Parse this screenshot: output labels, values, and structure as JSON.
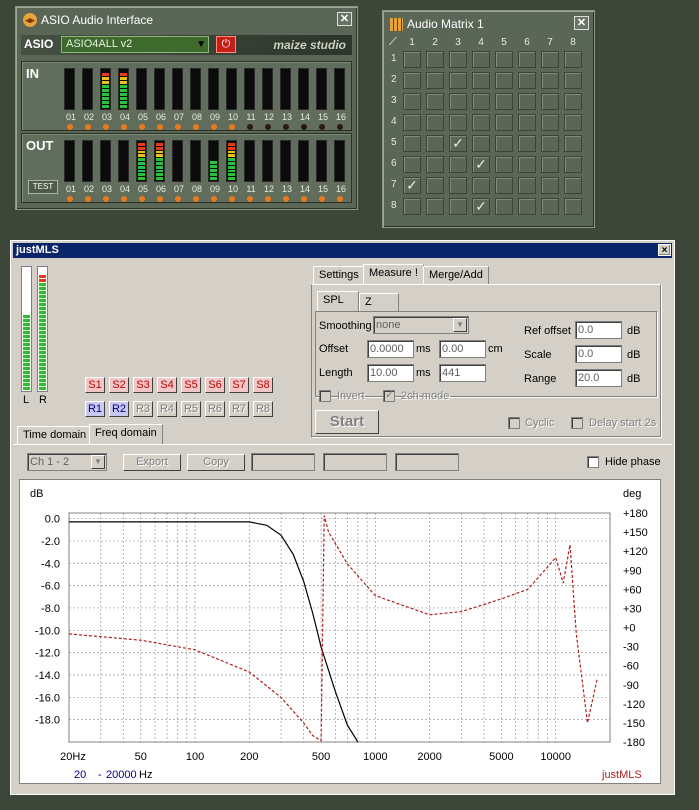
{
  "asio": {
    "title": "ASIO Audio Interface",
    "close": "✕",
    "logo_text": "ASIO",
    "driver": "ASIO4ALL v2",
    "brand": "maize studio",
    "in_label": "IN",
    "out_label": "OUT",
    "test_label": "TEST",
    "channels": [
      "01",
      "02",
      "03",
      "04",
      "05",
      "06",
      "07",
      "08",
      "09",
      "10",
      "11",
      "12",
      "13",
      "14",
      "15",
      "16"
    ],
    "in_levels": [
      0,
      0,
      0.85,
      0.85,
      0,
      0,
      0,
      0,
      0,
      0,
      0,
      0,
      0,
      0,
      0,
      0
    ],
    "out_levels": [
      0,
      0,
      0,
      0,
      0.95,
      0.95,
      0,
      0,
      0.45,
      0.95,
      0,
      0,
      0,
      0,
      0,
      0
    ],
    "in_leds_active": [
      true,
      true,
      true,
      true,
      true,
      true,
      true,
      true,
      true,
      true,
      false,
      false,
      false,
      false,
      false,
      false
    ],
    "out_leds_active": [
      true,
      true,
      true,
      true,
      true,
      true,
      true,
      true,
      true,
      true,
      true,
      true,
      true,
      true,
      true,
      true
    ]
  },
  "matrix": {
    "title": "Audio Matrix 1",
    "close": "✕",
    "cols": [
      "1",
      "2",
      "3",
      "4",
      "5",
      "6",
      "7",
      "8"
    ],
    "rows": [
      "1",
      "2",
      "3",
      "4",
      "5",
      "6",
      "7",
      "8"
    ],
    "checks": [
      [
        5,
        3
      ],
      [
        6,
        4
      ],
      [
        7,
        1
      ],
      [
        8,
        4
      ]
    ],
    "check_glyph": "✓"
  },
  "mls": {
    "title": "justMLS",
    "close": "×",
    "meter_labels": [
      "L",
      "R"
    ],
    "meter_levels": [
      0.62,
      0.95
    ],
    "s_buttons": [
      "S1",
      "S2",
      "S3",
      "S4",
      "S5",
      "S6",
      "S7",
      "S8"
    ],
    "r_buttons": [
      "R1",
      "R2",
      "R3",
      "R4",
      "R5",
      "R6",
      "R7",
      "R8"
    ],
    "r_active": [
      true,
      true,
      false,
      false,
      false,
      false,
      false,
      false
    ],
    "tabs_top": [
      "Settings",
      "Measure !",
      "Merge/Add"
    ],
    "subtabs": [
      "SPL",
      "Z"
    ],
    "smoothing_label": "Smoothing",
    "smoothing_value": "none",
    "offset_label": "Offset",
    "offset_ms": "0.0000",
    "ms1": "ms",
    "offset_cm": "0.00",
    "cm": "cm",
    "length_label": "Length",
    "length_ms": "10.00",
    "ms2": "ms",
    "length_samples": "441",
    "invert_label": "Invert",
    "twoch_label": "2ch mode",
    "ref_offset_label": "Ref offset",
    "ref_offset_value": "0.0",
    "scale_label": "Scale",
    "scale_value": "0.0",
    "range_label": "Range",
    "range_value": "20.0",
    "db1": "dB",
    "db2": "dB",
    "db3": "dB",
    "start_label": "Start",
    "cyclic_label": "Cyclic",
    "delay_label": "Delay start 2s",
    "domain_tabs": [
      "Time domain",
      "Freq domain"
    ],
    "channel_select": "Ch 1 - 2",
    "export_label": "Export",
    "copy_label": "Copy",
    "hide_phase_label": "Hide phase",
    "plot": {
      "left_unit": "dB",
      "right_unit": "deg",
      "freq_from": "20",
      "freq_to": "20000",
      "freq_unit": "Hz",
      "watermark": "justMLS"
    }
  },
  "chart_data": {
    "type": "line",
    "xscale": "log",
    "xlim": [
      20,
      20000
    ],
    "ylim": [
      -20,
      0.5
    ],
    "y2lim": [
      -180,
      180
    ],
    "x_ticks": [
      "20Hz",
      "50",
      "100",
      "200",
      "500",
      "1000",
      "2000",
      "5000",
      "10000"
    ],
    "x_tick_values": [
      20,
      50,
      100,
      200,
      500,
      1000,
      2000,
      5000,
      10000
    ],
    "y_ticks": [
      "0.0",
      "-2.0",
      "-4.0",
      "-6.0",
      "-8.0",
      "-10.0",
      "-12.0",
      "-14.0",
      "-16.0",
      "-18.0"
    ],
    "y2_ticks": [
      "+180",
      "+150",
      "+120",
      "+90",
      "+60",
      "+30",
      "+0",
      "-30",
      "-60",
      "-90",
      "-120",
      "-150",
      "-180"
    ],
    "xlabel": "",
    "ylabel": "dB",
    "y2label": "deg",
    "grid": true,
    "series": [
      {
        "color": "#000000",
        "axis": "left",
        "x": [
          20,
          100,
          200,
          250,
          300,
          350,
          400,
          450,
          500,
          600,
          700,
          800
        ],
        "y": [
          -0.3,
          -0.3,
          -0.3,
          -0.6,
          -1.5,
          -3.2,
          -5.6,
          -8.5,
          -11.5,
          -15.5,
          -18.5,
          -20
        ]
      },
      {
        "color": "#b02020",
        "axis": "right",
        "dashed": true,
        "x": [
          20,
          50,
          100,
          200,
          300,
          400,
          450,
          500,
          520,
          550,
          700,
          1000,
          2000,
          3000,
          5000,
          7000,
          9000,
          10000,
          11000,
          12000,
          13000,
          15000,
          17000
        ],
        "y": [
          -10,
          -20,
          -35,
          -70,
          -110,
          -150,
          -170,
          -178,
          176,
          150,
          100,
          50,
          20,
          25,
          45,
          60,
          95,
          110,
          70,
          130,
          -10,
          -150,
          -80
        ]
      }
    ]
  }
}
